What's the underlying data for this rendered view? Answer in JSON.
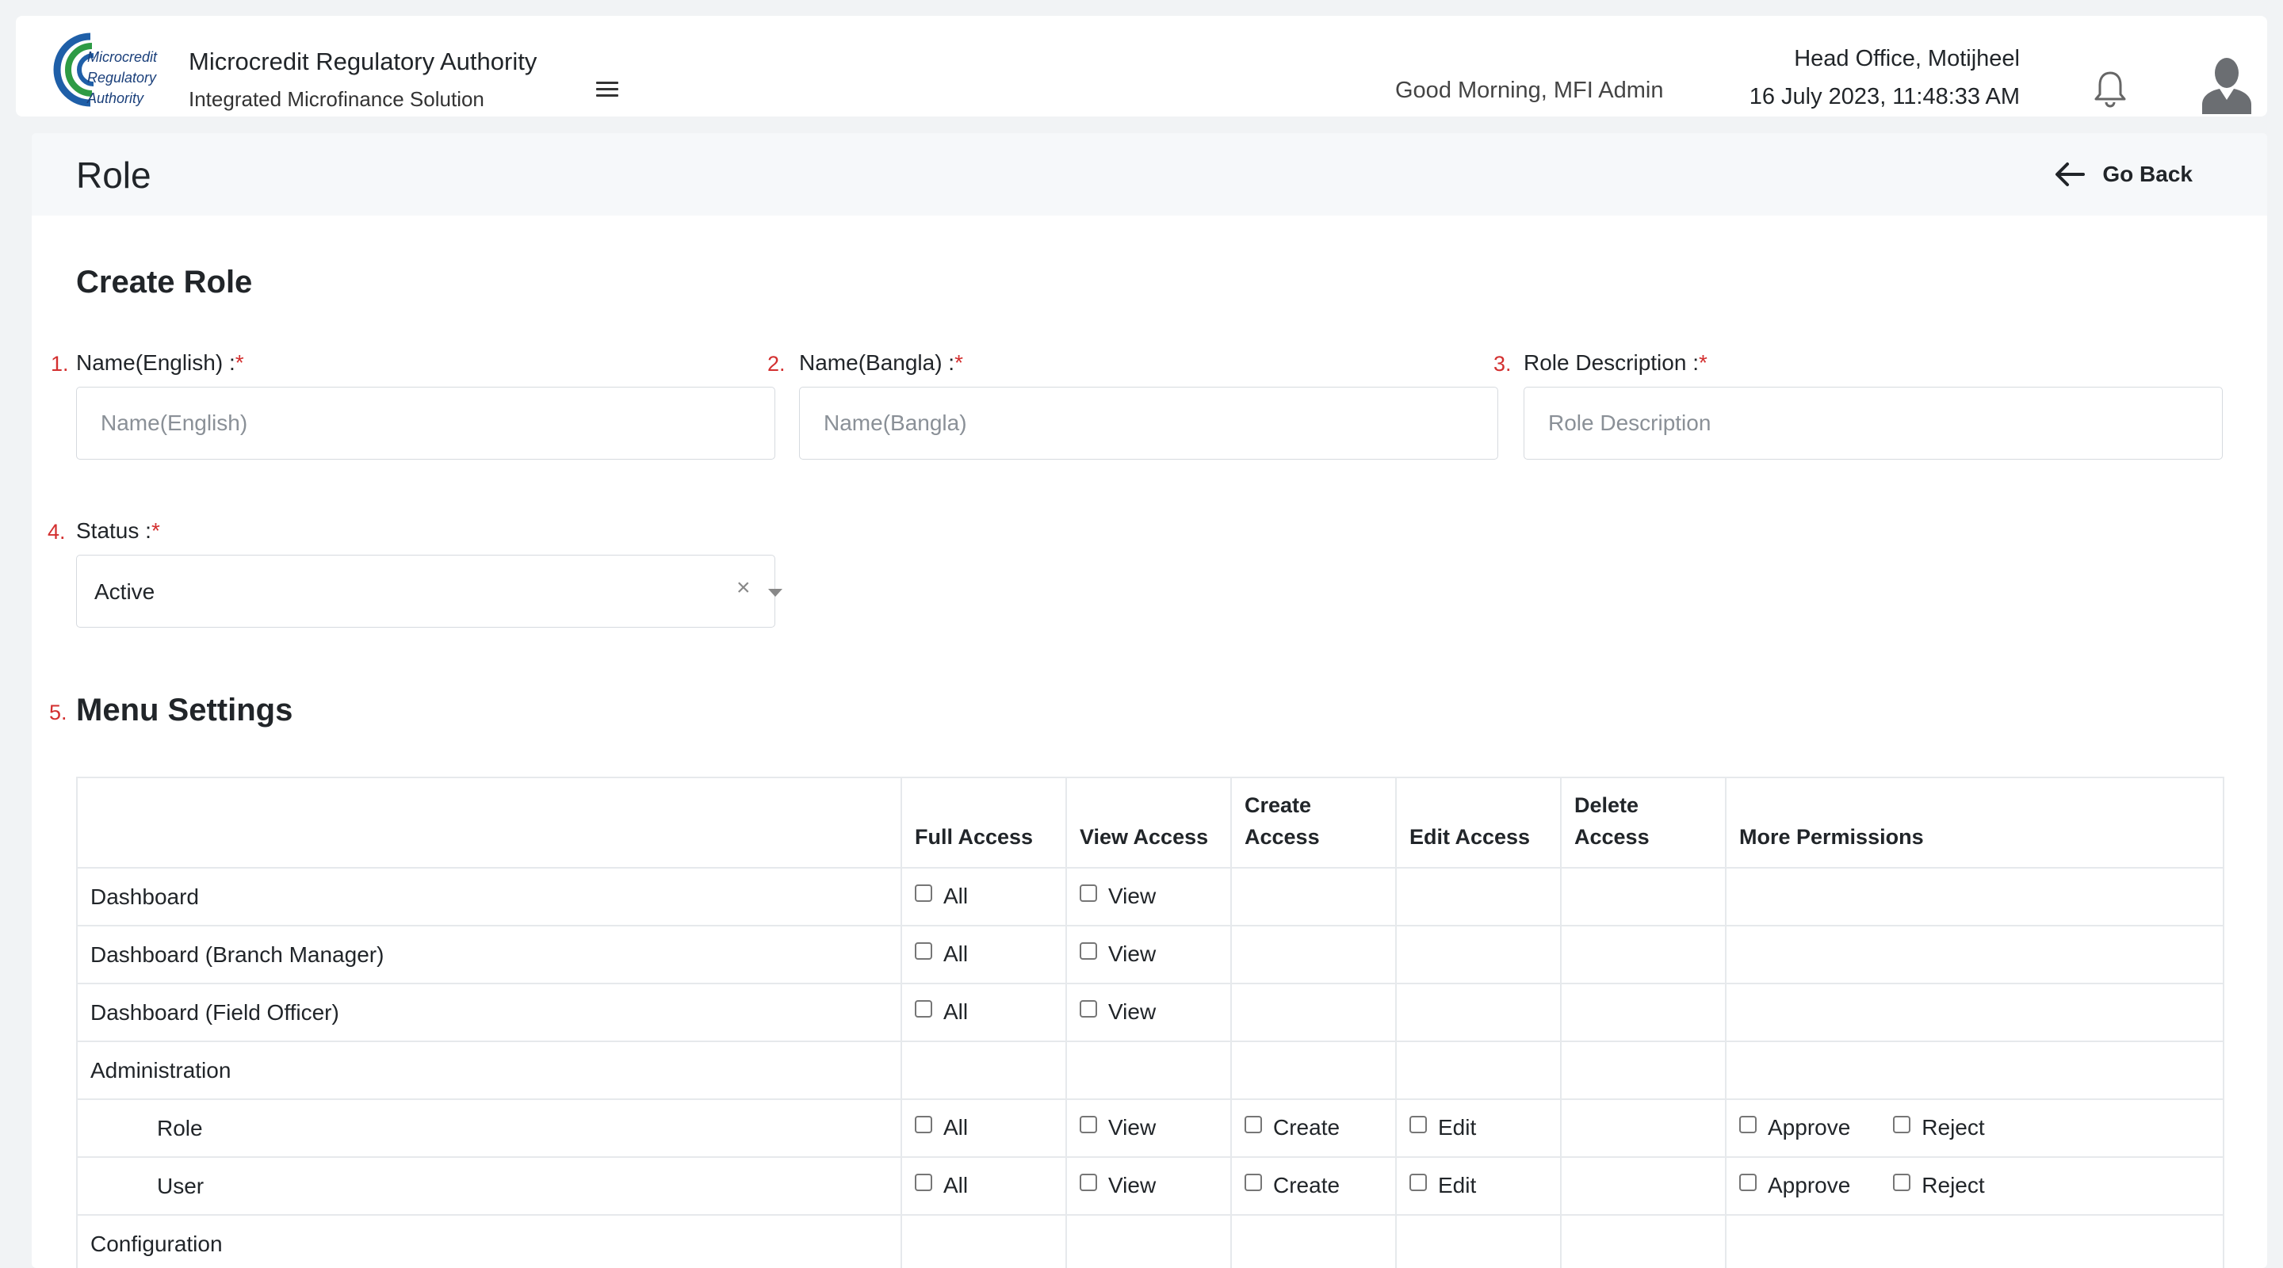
{
  "header": {
    "logo_text": [
      "Microcredit",
      "Regulatory",
      "Authority"
    ],
    "org_name": "Microcredit Regulatory Authority",
    "org_sub": "Integrated Microfinance Solution",
    "greeting": "Good Morning, MFI Admin",
    "office": "Head Office, Motijheel",
    "datetime": "16 July 2023, 11:48:33 AM"
  },
  "page": {
    "title": "Role",
    "go_back": "Go Back",
    "section_title": "Create Role"
  },
  "form": {
    "name_en": {
      "num": "1.",
      "label": "Name(English) :",
      "required": "*",
      "placeholder": "Name(English)",
      "value": ""
    },
    "name_bn": {
      "num": "2.",
      "label": "Name(Bangla) :",
      "required": "*",
      "placeholder": "Name(Bangla)",
      "value": ""
    },
    "description": {
      "num": "3.",
      "label": "Role Description :",
      "required": "*",
      "placeholder": "Role Description",
      "value": ""
    },
    "status": {
      "num": "4.",
      "label": "Status :",
      "required": "*",
      "value": "Active",
      "clear": "×"
    }
  },
  "menu_settings": {
    "num": "5.",
    "title": "Menu Settings",
    "columns": [
      "",
      "Full Access",
      "View Access",
      "Create Access",
      "Edit Access",
      "Delete Access",
      "More Permissions"
    ],
    "rows": [
      {
        "label": "Dashboard",
        "child": false,
        "full": "All",
        "view": "View"
      },
      {
        "label": "Dashboard (Branch Manager)",
        "child": false,
        "full": "All",
        "view": "View"
      },
      {
        "label": "Dashboard (Field Officer)",
        "child": false,
        "full": "All",
        "view": "View"
      },
      {
        "label": "Administration",
        "child": false
      },
      {
        "label": "Role",
        "child": true,
        "full": "All",
        "view": "View",
        "create": "Create",
        "edit": "Edit",
        "more": [
          "Approve",
          "Reject"
        ]
      },
      {
        "label": "User",
        "child": true,
        "full": "All",
        "view": "View",
        "create": "Create",
        "edit": "Edit",
        "more": [
          "Approve",
          "Reject"
        ]
      },
      {
        "label": "Configuration",
        "child": false
      }
    ]
  },
  "colors": {
    "required": "#d32f2f",
    "logo_green": "#2e9b45",
    "logo_blue": "#1f5fa8"
  }
}
